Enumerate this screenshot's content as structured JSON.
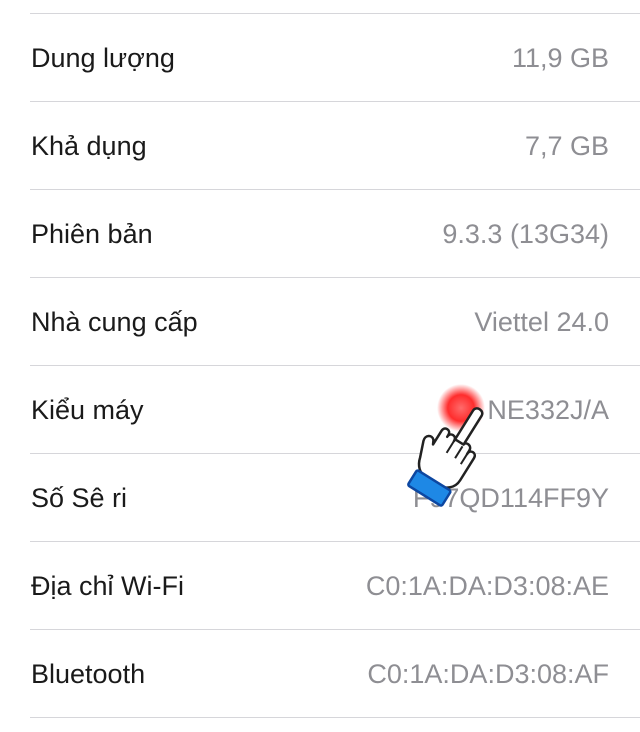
{
  "rows": [
    {
      "label": "Dung lượng",
      "value": "11,9 GB"
    },
    {
      "label": "Khả dụng",
      "value": "7,7 GB"
    },
    {
      "label": "Phiên bản",
      "value": "9.3.3 (13G34)"
    },
    {
      "label": "Nhà cung cấp",
      "value": "Viettel 24.0"
    },
    {
      "label": "Kiểu máy",
      "value": "NE332J/A"
    },
    {
      "label": "Số Sê ri",
      "value": "F97QD114FF9Y"
    },
    {
      "label": "Địa chỉ Wi-Fi",
      "value": "C0:1A:DA:D3:08:AE"
    },
    {
      "label": "Bluetooth",
      "value": "C0:1A:DA:D3:08:AF"
    }
  ],
  "icons": {
    "tap_indicator": "pointing-hand-icon"
  },
  "colors": {
    "label": "#1a1a1a",
    "value": "#8e8e93",
    "divider": "#d6d6da",
    "tap_dot": "#ff3b30",
    "cuff": "#1e88e5"
  }
}
